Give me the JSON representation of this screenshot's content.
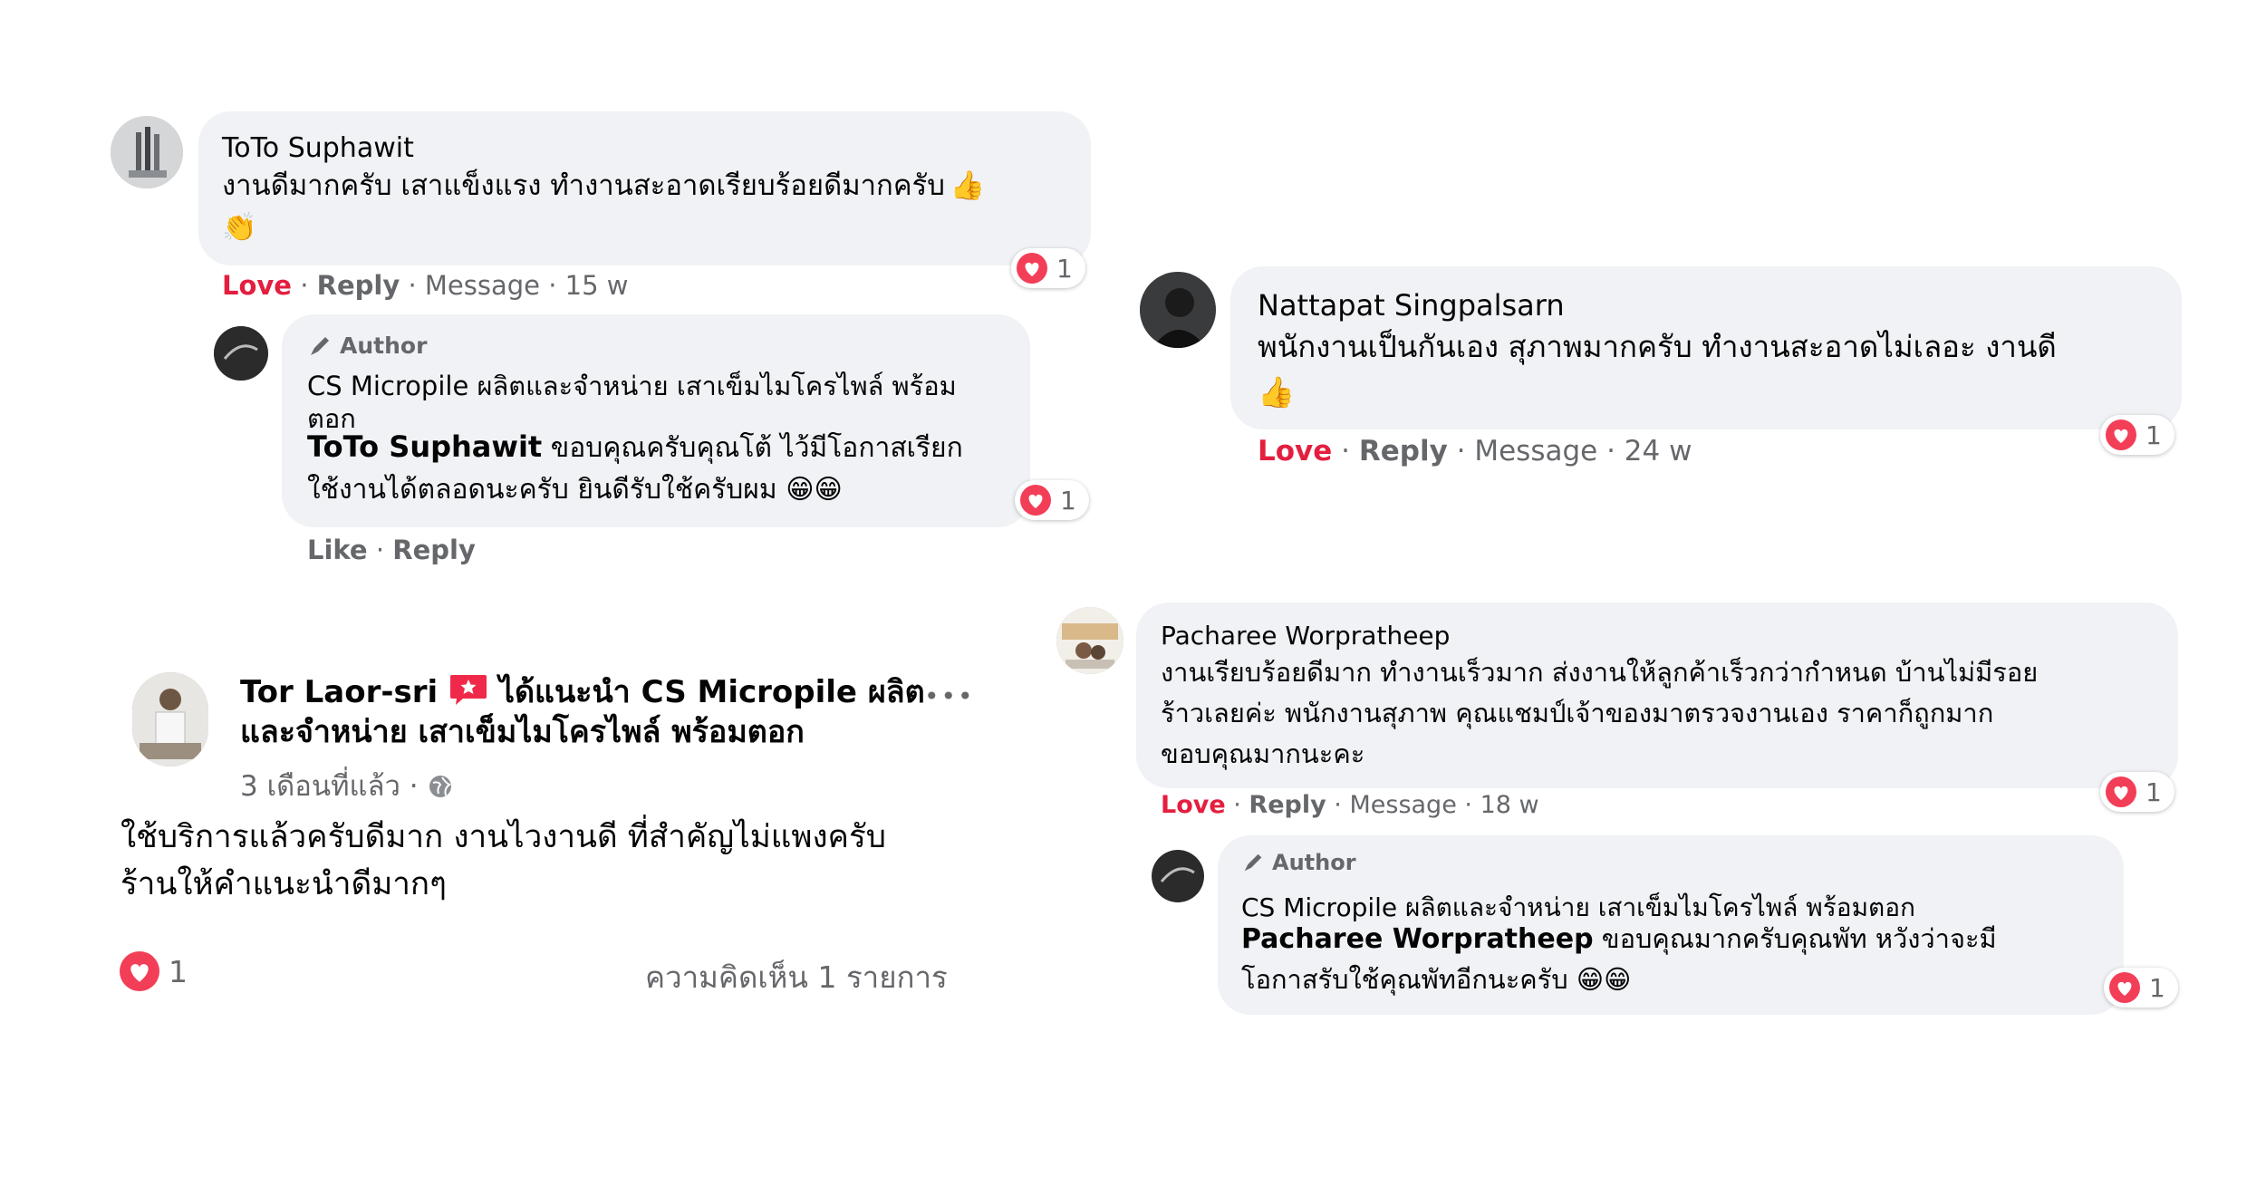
{
  "comment1": {
    "author": "ToTo Suphawit",
    "text_line1": "งานดีมากครับ เสาแข็งแรง ทำงานสะอาดเรียบร้อยดีมากครับ",
    "love": "Love",
    "reply": "Reply",
    "message": "Message",
    "time": "15 w",
    "reaction_count": "1",
    "reply1": {
      "author_badge": "Author",
      "author": "CS Micropile ผลิตและจำหน่าย เสาเข็มไมโครไพล์ พร้อมตอก",
      "mention": "ToTo Suphawit",
      "text_line1": "ขอบคุณครับคุณโต้ ไว้มีโอกาสเรียก",
      "text_line2": "ใช้งานได้ตลอดนะครับ ยินดีรับใช้ครับผม",
      "like": "Like",
      "reply": "Reply",
      "reaction_count": "1"
    }
  },
  "comment2": {
    "author": "Nattapat Singpalsarn",
    "text_line1": "พนักงานเป็นกันเอง สุภาพมากครับ ทำงานสะอาดไม่เลอะ งานดี",
    "love": "Love",
    "reply": "Reply",
    "message": "Message",
    "time": "24 w",
    "reaction_count": "1"
  },
  "comment3": {
    "author": "Pacharee Worpratheep",
    "text_line1": "งานเรียบร้อยดีมาก ทำงานเร็วมาก ส่งงานให้ลูกค้าเร็วกว่ากำหนด บ้านไม่มีรอย",
    "text_line2": "ร้าวเลยค่ะ พนักงานสุภาพ คุณแชมป์เจ้าของมาตรวจงานเอง ราคาก็ถูกมาก",
    "text_line3": "ขอบคุณมากนะคะ",
    "love": "Love",
    "reply": "Reply",
    "message": "Message",
    "time": "18 w",
    "reaction_count": "1",
    "reply1": {
      "author_badge": "Author",
      "author": "CS Micropile ผลิตและจำหน่าย เสาเข็มไมโครไพล์ พร้อมตอก",
      "mention": "Pacharee Worpratheep",
      "text_line1": "ขอบคุณมากครับคุณพัท หวังว่าจะมี",
      "text_line2": "โอกาสรับใช้คุณพัทอีกนะครับ",
      "reaction_count": "1"
    }
  },
  "post": {
    "author": "Tor Laor-sri",
    "recommend": "ได้แนะนำ CS Micropile ผลิต",
    "recommend_line2": "และจำหน่าย เสาเข็มไมโครไพล์ พร้อมตอก",
    "time": "3 เดือนที่แล้ว ·",
    "more": "•••",
    "body_line1": "ใช้บริการแล้วครับดีมาก งานไวงานดี ที่สำคัญไม่แพงครับ",
    "body_line2": "ร้านให้คำแนะนำดีมากๆ",
    "reaction_count": "1",
    "comments_count": "ความคิดเห็น 1 รายการ"
  },
  "colors": {
    "love": "#e41e3f",
    "bubble": "#f0f2f5",
    "meta": "#65676b",
    "recommend": "#f02849"
  }
}
